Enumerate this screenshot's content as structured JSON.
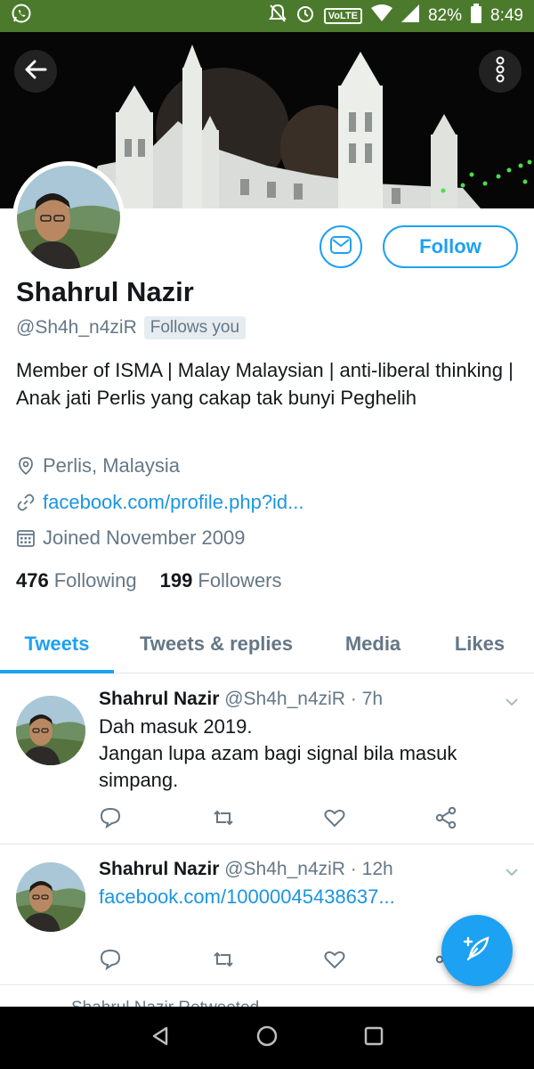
{
  "status_bar": {
    "battery": "82%",
    "time": "8:49",
    "volte": "VoLTE",
    "icons": [
      "whatsapp-icon",
      "mute-icon",
      "alarm-icon",
      "wifi-icon",
      "signal-icon",
      "battery-icon"
    ]
  },
  "header": {
    "back_icon": "back-arrow-icon",
    "more_icon": "more-vertical-icon"
  },
  "profile": {
    "name": "Shahrul Nazir",
    "handle": "@Sh4h_n4ziR",
    "follows_you": "Follows you",
    "bio": "Member of ISMA | Malay Malaysian | anti-liberal thinking | Anak jati Perlis yang cakap tak bunyi Peghelih",
    "location": "Perlis, Malaysia",
    "website": "facebook.com/profile.php?id...",
    "joined": "Joined November 2009",
    "following_count": "476",
    "following_label": "Following",
    "followers_count": "199",
    "followers_label": "Followers",
    "follow_button": "Follow",
    "message_icon": "mail-icon"
  },
  "tabs": [
    {
      "label": "Tweets",
      "active": true
    },
    {
      "label": "Tweets & replies",
      "active": false
    },
    {
      "label": "Media",
      "active": false
    },
    {
      "label": "Likes",
      "active": false
    }
  ],
  "tweets": [
    {
      "name": "Shahrul Nazir",
      "handle": "@Sh4h_n4ziR",
      "time": "7h",
      "text": "Dah masuk 2019.\nJangan lupa azam bagi signal bila masuk simpang.",
      "link": ""
    },
    {
      "name": "Shahrul Nazir",
      "handle": "@Sh4h_n4ziR",
      "time": "12h",
      "text": "",
      "link": "facebook.com/10000045438637..."
    }
  ],
  "retweet_peek": "Shahrul Nazir Retweeted",
  "colors": {
    "accent": "#1da1f2",
    "status_bar": "#4b7a2c",
    "secondary_text": "#657786"
  }
}
